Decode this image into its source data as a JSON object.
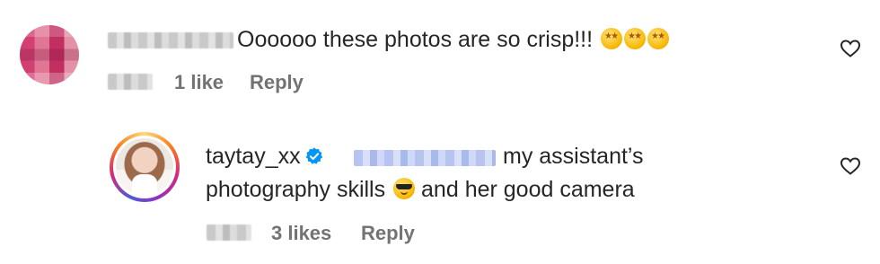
{
  "comment": {
    "text": "Oooooo these photos are so crisp!!!",
    "emojis": [
      "star-struck",
      "star-struck",
      "star-struck"
    ],
    "likes": "1 like",
    "reply_label": "Reply"
  },
  "reply": {
    "username": "taytay_xx",
    "verified": true,
    "text_line1": "my assistant’s",
    "text_line2_prefix": "photography skills",
    "emoji": "smiling-face-with-sunglasses",
    "text_line2_suffix": "and her good camera",
    "likes": "3 likes",
    "reply_label": "Reply"
  },
  "colors": {
    "text": "#262626",
    "meta": "#737373",
    "verified": "#0095f6"
  }
}
